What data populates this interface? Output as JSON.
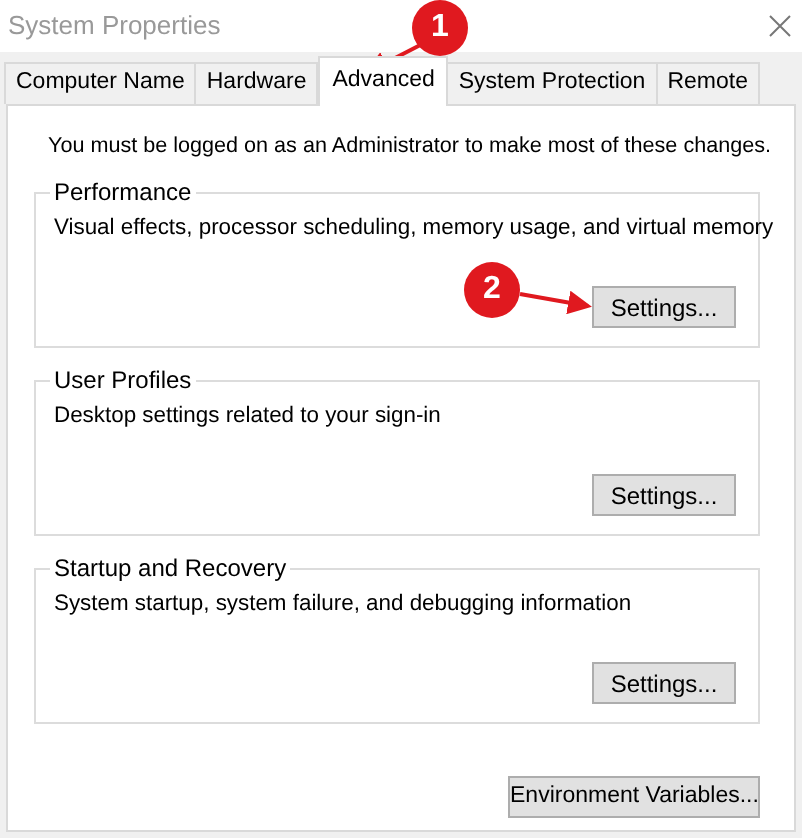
{
  "window": {
    "title": "System Properties"
  },
  "tabs": [
    {
      "label": "Computer Name",
      "selected": false
    },
    {
      "label": "Hardware",
      "selected": false
    },
    {
      "label": "Advanced",
      "selected": true
    },
    {
      "label": "System Protection",
      "selected": false
    },
    {
      "label": "Remote",
      "selected": false
    }
  ],
  "notice": "You must be logged on as an Administrator to make most of these changes.",
  "groups": [
    {
      "title": "Performance",
      "description": "Visual effects, processor scheduling, memory usage, and virtual memory",
      "button": "Settings..."
    },
    {
      "title": "User Profiles",
      "description": "Desktop settings related to your sign-in",
      "button": "Settings..."
    },
    {
      "title": "Startup and Recovery",
      "description": "System startup, system failure, and debugging information",
      "button": "Settings..."
    }
  ],
  "bottom_button": "Environment Variables...",
  "annotations": [
    {
      "label": "1"
    },
    {
      "label": "2"
    }
  ]
}
